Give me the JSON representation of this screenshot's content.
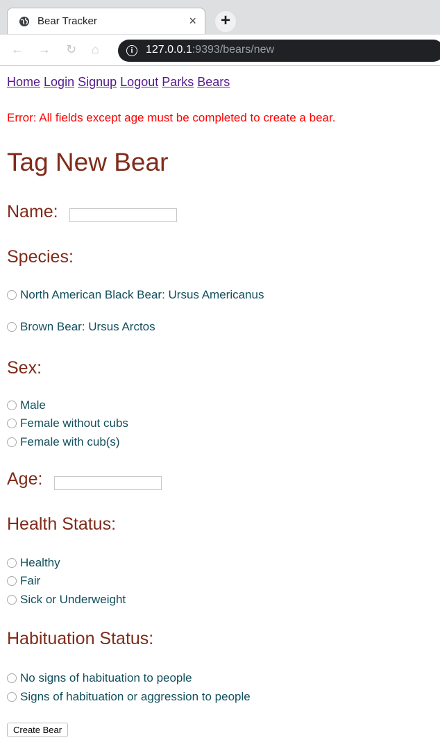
{
  "browser": {
    "tab_title": "Bear Tracker",
    "tab_close": "×",
    "new_tab": "+",
    "url_host": "127.0.0.1",
    "url_rest": ":9393/bears/new",
    "icons": [
      "globe-icon",
      "back-icon",
      "forward-icon",
      "reload-icon",
      "home-icon",
      "info-icon"
    ]
  },
  "nav": [
    "Home",
    "Login",
    "Signup",
    "Logout",
    "Parks",
    "Bears"
  ],
  "error": "Error: All fields except age must be completed to create a bear.",
  "title": "Tag New Bear",
  "labels": {
    "name": "Name:",
    "species": "Species:",
    "sex": "Sex:",
    "age": "Age:",
    "health": "Health Status:",
    "habituation": "Habituation Status:"
  },
  "species_options": [
    "North American Black Bear: Ursus Americanus",
    "Brown Bear: Ursus Arctos"
  ],
  "sex_options": [
    "Male",
    "Female without cubs",
    "Female with cub(s)"
  ],
  "health_options": [
    "Healthy",
    "Fair",
    "Sick or Underweight"
  ],
  "habituation_options": [
    "No signs of habituation to people",
    "Signs of habituation or aggression to people"
  ],
  "submit_label": "Create Bear",
  "colors": {
    "heading": "#802b1a",
    "option_text": "#124f5c",
    "error": "#ff0000",
    "link": "#551a8b"
  }
}
